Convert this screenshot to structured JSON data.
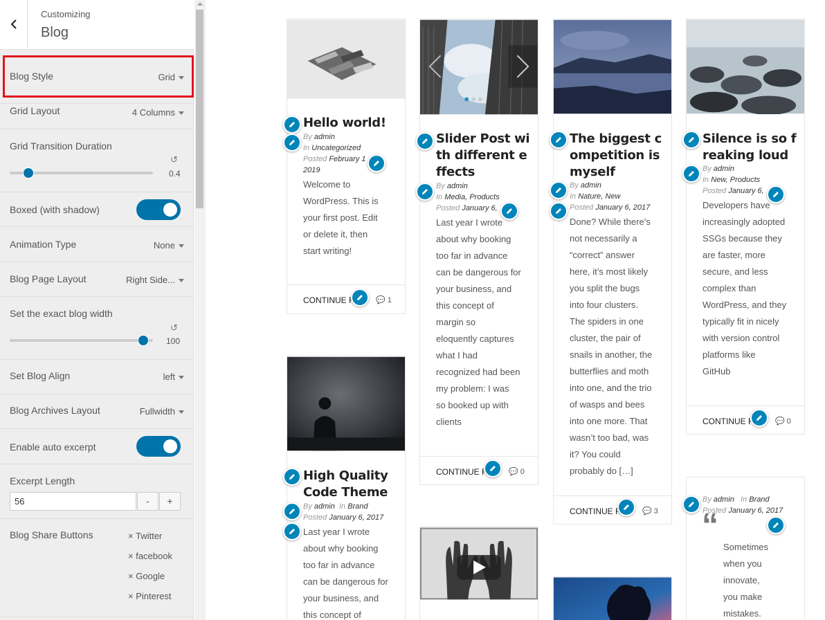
{
  "sidebar": {
    "subtitle": "Customizing",
    "title": "Blog",
    "blog_style": {
      "label": "Blog Style",
      "value": "Grid"
    },
    "grid_layout": {
      "label": "Grid Layout",
      "value": "4 Columns"
    },
    "grid_transition": {
      "label": "Grid Transition Duration",
      "value": "0.4",
      "level": 0.1
    },
    "boxed": {
      "label": "Boxed (with shadow)",
      "on": true
    },
    "animation": {
      "label": "Animation Type",
      "value": "None"
    },
    "page_layout": {
      "label": "Blog Page Layout",
      "value": "Right Side..."
    },
    "blog_width": {
      "label": "Set the exact blog width",
      "value": "100",
      "level": 1.0
    },
    "blog_align": {
      "label": "Set Blog Align",
      "value": "left"
    },
    "archives": {
      "label": "Blog Archives Layout",
      "value": "Fullwidth"
    },
    "auto_excerpt": {
      "label": "Enable auto excerpt",
      "on": true
    },
    "excerpt_length": {
      "label": "Excerpt Length",
      "value": "56",
      "minus": "-",
      "plus": "+"
    },
    "share": {
      "label": "Blog Share Buttons",
      "items": [
        "× Twitter",
        "× facebook",
        "× Google",
        "× Pinterest"
      ]
    }
  },
  "posts": {
    "p1": {
      "title": "Hello world!",
      "by": "By",
      "author": "admin",
      "in": "In",
      "cats": "Uncategorized",
      "posted": "Posted",
      "date1": "February 1",
      "date2": "2019",
      "lines": [
        "Welcome to",
        "WordPress. This is",
        "your first post. Edit",
        "or delete it, then",
        "start writing!"
      ],
      "more": "CONTINUE R",
      "comments": "1"
    },
    "p2": {
      "title_lines": [
        "Slider Post wi",
        "th different e",
        "ffects"
      ],
      "by": "By",
      "author": "admin",
      "in": "In",
      "cats": "Media, Products",
      "posted": "Posted",
      "date": "January 6,",
      "lines": [
        "Last year I wrote",
        "about why booking",
        "too far in advance",
        "can be dangerous for",
        "your business, and",
        "this concept of",
        "margin so",
        "eloquently captures",
        "what I had",
        "recognized had been",
        "my problem: I was",
        "so booked up with",
        "clients"
      ],
      "more": "CONTINUE R",
      "comments": "0"
    },
    "p3": {
      "title_lines": [
        "The biggest c",
        "ompetition is",
        "myself"
      ],
      "by": "By",
      "author": "admin",
      "in": "In",
      "cats": "Nature, New",
      "posted": "Posted",
      "date": "January 6, 2017",
      "lines": [
        "Done? While there’s",
        "not necessarily a",
        "“correct” answer",
        "here, it’s most likely",
        "you split the bugs",
        "into four clusters.",
        "The spiders in one",
        "cluster, the pair of",
        "snails in another, the",
        "butterflies and moth",
        "into one, and the trio",
        "of wasps and bees",
        "into one more. That",
        "wasn’t too bad, was",
        "it? You could",
        "probably do […]"
      ],
      "more": "CONTINUE R",
      "comments": "3"
    },
    "p4": {
      "title_lines": [
        "Silence is so f",
        "reaking loud"
      ],
      "by": "By",
      "author": "admin",
      "in": "In",
      "cats": "New, Products",
      "posted": "Posted",
      "date": "January 6,",
      "lines": [
        "Developers have",
        "increasingly adopted",
        "SSGs because they",
        "are faster, more",
        "secure, and less",
        "complex than",
        "WordPress, and they",
        "typically fit in nicely",
        "with version control",
        "platforms like",
        "GitHub"
      ],
      "more": "CONTINUE R",
      "comments": "0"
    },
    "p5": {
      "title_lines": [
        "High Quality",
        "Code Theme"
      ],
      "by": "By",
      "author": "admin",
      "in": "In",
      "cats": "Brand",
      "posted": "Posted",
      "date": "January 6, 2017",
      "lines": [
        "Last year I wrote",
        "about why booking",
        "too far in advance",
        "can be dangerous for",
        "your business, and",
        "this concept of"
      ]
    },
    "p8": {
      "by": "By",
      "author": "admin",
      "in": "In",
      "cats": "Brand",
      "posted": "Posted",
      "date": "January 6, 2017",
      "quote_mark": "“",
      "lines": [
        "Sometimes",
        "when you",
        "innovate,",
        "you make",
        "mistakes."
      ]
    }
  },
  "colors": {
    "accent": "#0073aa",
    "highlight": "#e3121b",
    "edit_pin": "#0085ba"
  }
}
